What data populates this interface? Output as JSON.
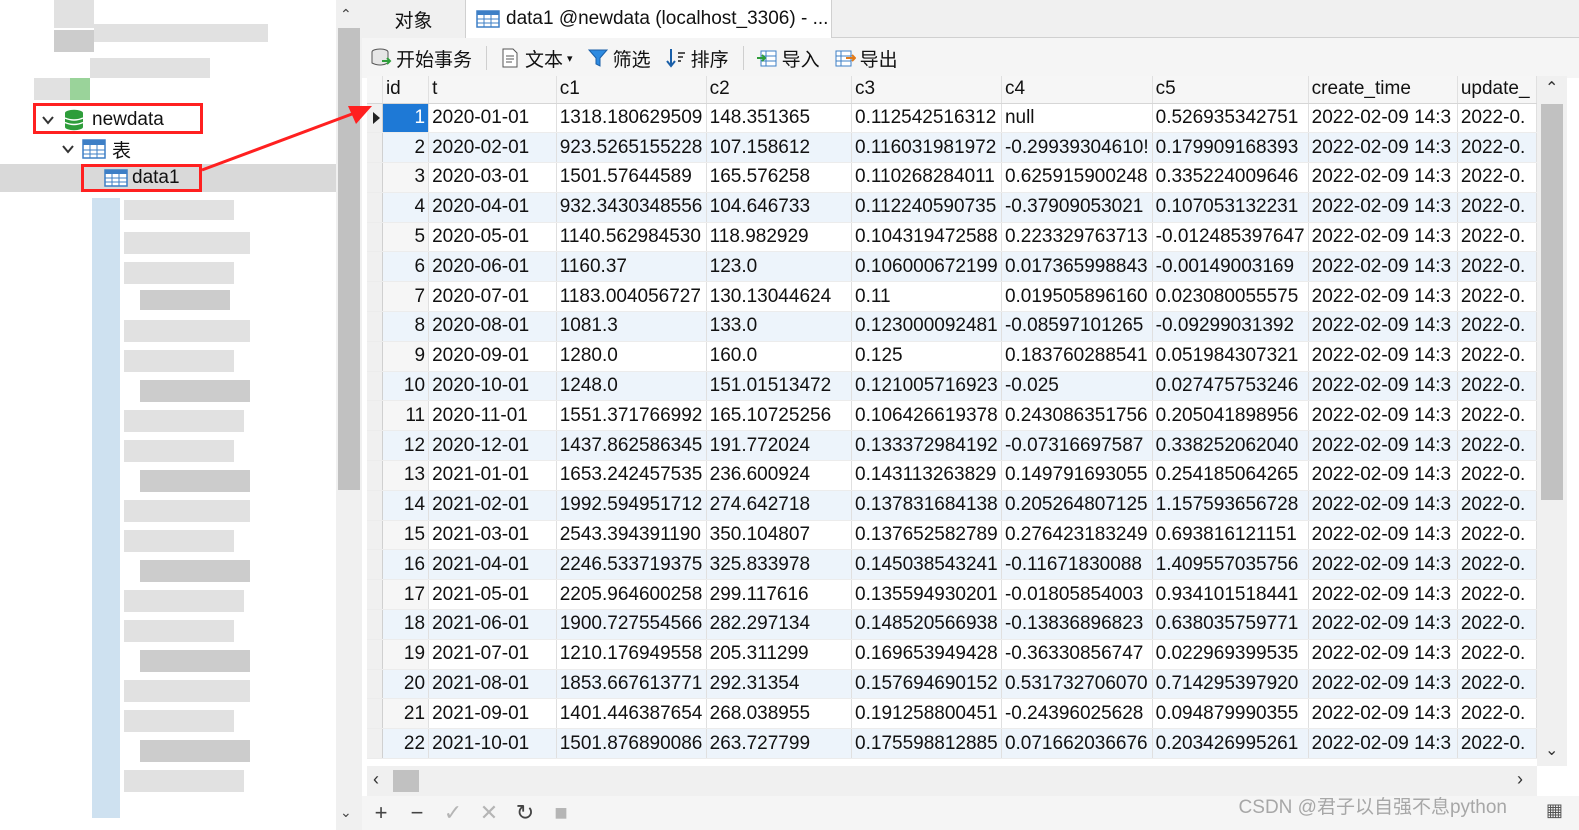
{
  "navigator": {
    "database": "newdata",
    "tables_folder": "表",
    "table": "data1"
  },
  "tabs": {
    "objects": "对象",
    "active": "data1 @newdata (localhost_3306) - ..."
  },
  "toolbar": {
    "begin_transaction": "开始事务",
    "text": "文本",
    "filter": "筛选",
    "sort": "排序",
    "import": "导入",
    "export": "导出"
  },
  "grid": {
    "columns": [
      "id",
      "t",
      "c1",
      "c2",
      "c3",
      "c4",
      "c5",
      "create_time",
      "update_"
    ],
    "rows": [
      [
        "1",
        "2020-01-01",
        "1318.180629509",
        "148.351365",
        "0.112542516312",
        "null",
        "0.526935342751",
        "2022-02-09 14:3",
        "2022-0."
      ],
      [
        "2",
        "2020-02-01",
        "923.5265155228",
        "107.158612",
        "0.116031981972",
        "-0.29939304610!",
        "0.179909168393",
        "2022-02-09 14:3",
        "2022-0."
      ],
      [
        "3",
        "2020-03-01",
        "1501.57644589",
        "165.576258",
        "0.110268284011",
        "0.625915900248",
        "0.335224009646",
        "2022-02-09 14:3",
        "2022-0."
      ],
      [
        "4",
        "2020-04-01",
        "932.3430348556",
        "104.646733",
        "0.112240590735",
        "-0.37909053021",
        "0.107053132231",
        "2022-02-09 14:3",
        "2022-0."
      ],
      [
        "5",
        "2020-05-01",
        "1140.562984530",
        "118.982929",
        "0.104319472588",
        "0.223329763713",
        "-0.012485397647",
        "2022-02-09 14:3",
        "2022-0."
      ],
      [
        "6",
        "2020-06-01",
        "1160.37",
        "123.0",
        "0.106000672199",
        "0.017365998843",
        "-0.00149003169",
        "2022-02-09 14:3",
        "2022-0."
      ],
      [
        "7",
        "2020-07-01",
        "1183.004056727",
        "130.13044624",
        "0.11",
        "0.019505896160",
        "0.023080055575",
        "2022-02-09 14:3",
        "2022-0."
      ],
      [
        "8",
        "2020-08-01",
        "1081.3",
        "133.0",
        "0.123000092481",
        "-0.08597101265",
        "-0.09299031392",
        "2022-02-09 14:3",
        "2022-0."
      ],
      [
        "9",
        "2020-09-01",
        "1280.0",
        "160.0",
        "0.125",
        "0.183760288541",
        "0.051984307321",
        "2022-02-09 14:3",
        "2022-0."
      ],
      [
        "10",
        "2020-10-01",
        "1248.0",
        "151.01513472",
        "0.121005716923",
        "-0.025",
        "0.027475753246",
        "2022-02-09 14:3",
        "2022-0."
      ],
      [
        "11",
        "2020-11-01",
        "1551.371766992",
        "165.10725256",
        "0.106426619378",
        "0.243086351756",
        "0.205041898956",
        "2022-02-09 14:3",
        "2022-0."
      ],
      [
        "12",
        "2020-12-01",
        "1437.862586345",
        "191.772024",
        "0.133372984192",
        "-0.07316697587",
        "0.338252062040",
        "2022-02-09 14:3",
        "2022-0."
      ],
      [
        "13",
        "2021-01-01",
        "1653.242457535",
        "236.600924",
        "0.143113263829",
        "0.149791693055",
        "0.254185064265",
        "2022-02-09 14:3",
        "2022-0."
      ],
      [
        "14",
        "2021-02-01",
        "1992.594951712",
        "274.642718",
        "0.137831684138",
        "0.205264807125",
        "1.157593656728",
        "2022-02-09 14:3",
        "2022-0."
      ],
      [
        "15",
        "2021-03-01",
        "2543.394391190",
        "350.104807",
        "0.137652582789",
        "0.276423183249",
        "0.693816121151",
        "2022-02-09 14:3",
        "2022-0."
      ],
      [
        "16",
        "2021-04-01",
        "2246.533719375",
        "325.833978",
        "0.145038543241",
        "-0.11671830088",
        "1.409557035756",
        "2022-02-09 14:3",
        "2022-0."
      ],
      [
        "17",
        "2021-05-01",
        "2205.964600258",
        "299.117616",
        "0.135594930201",
        "-0.01805854003",
        "0.934101518441",
        "2022-02-09 14:3",
        "2022-0."
      ],
      [
        "18",
        "2021-06-01",
        "1900.727554566",
        "282.297134",
        "0.148520566938",
        "-0.13836896823",
        "0.638035759771",
        "2022-02-09 14:3",
        "2022-0."
      ],
      [
        "19",
        "2021-07-01",
        "1210.176949558",
        "205.311299",
        "0.169653949428",
        "-0.36330856747",
        "0.022969399535",
        "2022-02-09 14:3",
        "2022-0."
      ],
      [
        "20",
        "2021-08-01",
        "1853.667613771",
        "292.31354",
        "0.157694690152",
        "0.531732706070",
        "0.714295397920",
        "2022-02-09 14:3",
        "2022-0."
      ],
      [
        "21",
        "2021-09-01",
        "1401.446387654",
        "268.038955",
        "0.191258800451",
        "-0.24396025628",
        "0.094879990355",
        "2022-02-09 14:3",
        "2022-0."
      ],
      [
        "22",
        "2021-10-01",
        "1501.876890086",
        "263.727799",
        "0.175598812885",
        "0.071662036676",
        "0.203426995261",
        "2022-02-09 14:3",
        "2022-0."
      ]
    ]
  },
  "watermark": "CSDN @君子以自强不息python",
  "colors": {
    "accent": "#1e79d6",
    "annotation": "#ff2020",
    "db_icon": "#2e9d3a",
    "alt_row": "#edf4fb"
  }
}
